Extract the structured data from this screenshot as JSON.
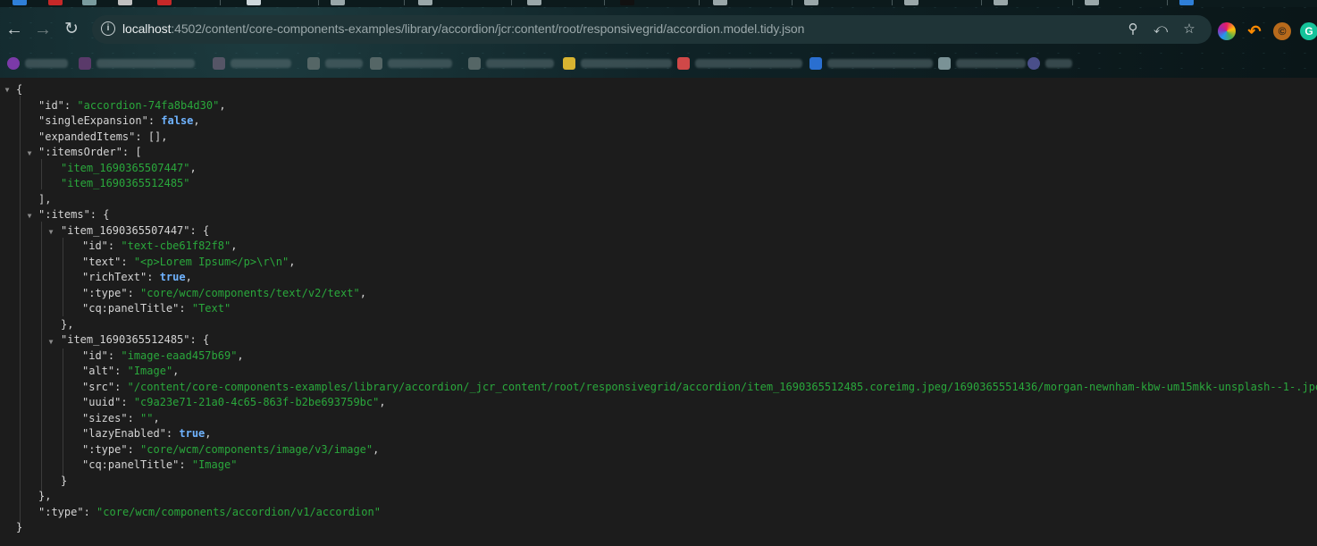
{
  "browser": {
    "url_host": "localhost",
    "url_rest": ":4502/content/core-components-examples/library/accordion/jcr:content/root/responsivegrid/accordion.model.tidy.json",
    "colors": {
      "accent": "#1f3437",
      "string": "#2aa83c",
      "boolean": "#6fb3ff"
    },
    "icons": {
      "back": "arrow-left-icon",
      "forward": "arrow-right-icon",
      "reload": "reload-icon",
      "site_info": "info-icon",
      "zoom": "zoom-icon",
      "share": "share-icon",
      "bookmark": "star-icon"
    },
    "extensions": [
      "colorzilla",
      "extension-orange",
      "extension-copper",
      "grammarly"
    ]
  },
  "json": {
    "id": "accordion-74fa8b4d30",
    "singleExpansion": "false",
    "expandedItems": "[]",
    "itemsOrder": [
      "item_1690365507447",
      "item_1690365512485"
    ],
    "item1": {
      "key": "item_1690365507447",
      "id": "text-cbe61f82f8",
      "text": "<p>Lorem Ipsum</p>\\r\\n",
      "richText": "true",
      "type": "core/wcm/components/text/v2/text",
      "panelTitle": "Text"
    },
    "item2": {
      "key": "item_1690365512485",
      "id": "image-eaad457b69",
      "alt": "Image",
      "src": "/content/core-components-examples/library/accordion/_jcr_content/root/responsivegrid/accordion/item_1690365512485.coreimg.jpeg/1690365551436/morgan-newnham-kbw-um15mkk-unsplash--1-.jpeg",
      "uuid": "c9a23e71-21a0-4c65-863f-b2be693759bc",
      "sizes": "",
      "lazyEnabled": "true",
      "type": "core/wcm/components/image/v3/image",
      "panelTitle": "Image"
    },
    "type": "core/wcm/components/accordion/v1/accordion"
  }
}
